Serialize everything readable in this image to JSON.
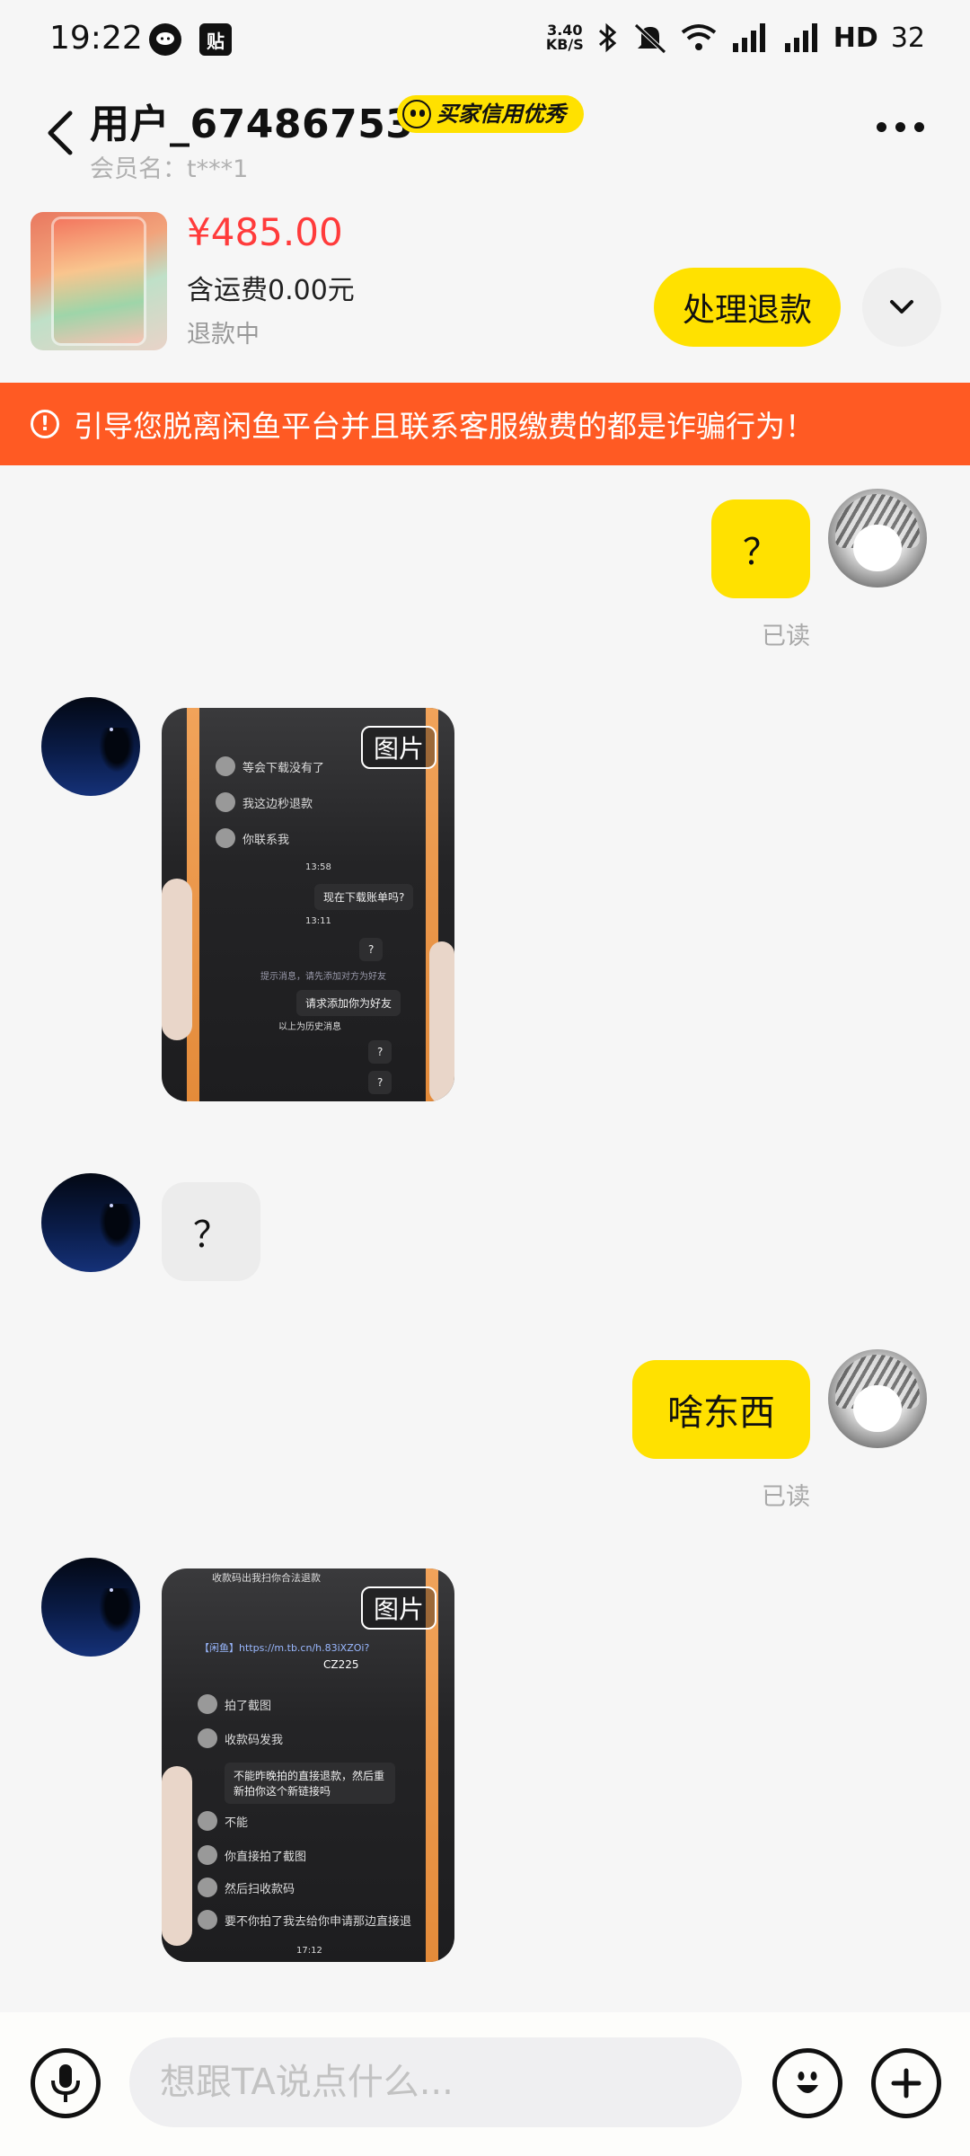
{
  "status_bar": {
    "time": "19:22",
    "app_icons": [
      "wechat-icon",
      "tieba-icon"
    ],
    "tieba_glyph": "贴",
    "net_speed_top": "3.40",
    "net_speed_bottom": "KB/S",
    "hd_label": "HD",
    "battery": "32"
  },
  "header": {
    "user_name": "用户_67486753",
    "badge": "买家信用优秀",
    "member_label": "会员名：t***1"
  },
  "order": {
    "price": "¥485.00",
    "shipping": "含运费0.00元",
    "status": "退款中",
    "refund_button": "处理退款"
  },
  "warning": {
    "icon_glyph": "!",
    "text": "引导您脱离闲鱼平台并且联系客服缴费的都是诈骗行为！"
  },
  "messages": [
    {
      "from": "me",
      "type": "text",
      "text": "？",
      "read": "已读"
    },
    {
      "from": "other",
      "type": "image",
      "tag": "图片",
      "shown_text": [
        "等会下载没有了",
        "我这边秒退款",
        "你联系我",
        "13:58",
        "现在下载账单吗?",
        "13:11",
        "?",
        "提示消息，请先添加对方为好友",
        "请求添加你为好友",
        "以上为历史消息",
        "?",
        "?"
      ]
    },
    {
      "from": "other",
      "type": "text",
      "text": "？"
    },
    {
      "from": "me",
      "type": "text",
      "text": "啥东西",
      "read": "已读"
    },
    {
      "from": "other",
      "type": "image",
      "tag": "图片",
      "shown_text": [
        "收款码出我扫你合法退款",
        "【闲鱼】https://m.tb.cn/h.83iXZOi?",
        "CZ225",
        "拍了截图",
        "收款码发我",
        "不能昨晚拍的直接退款，然后重新拍你这个新链接吗",
        "不能",
        "你直接拍了截图",
        "然后扫收款码",
        "要不你拍了我去给你申请那边直接退",
        "17:12"
      ]
    }
  ],
  "input": {
    "placeholder": "想跟TA说点什么..."
  },
  "colors": {
    "accent_yellow": "#ffe100",
    "warning_orange": "#ff5a23",
    "price_red": "#ff3b3b"
  }
}
